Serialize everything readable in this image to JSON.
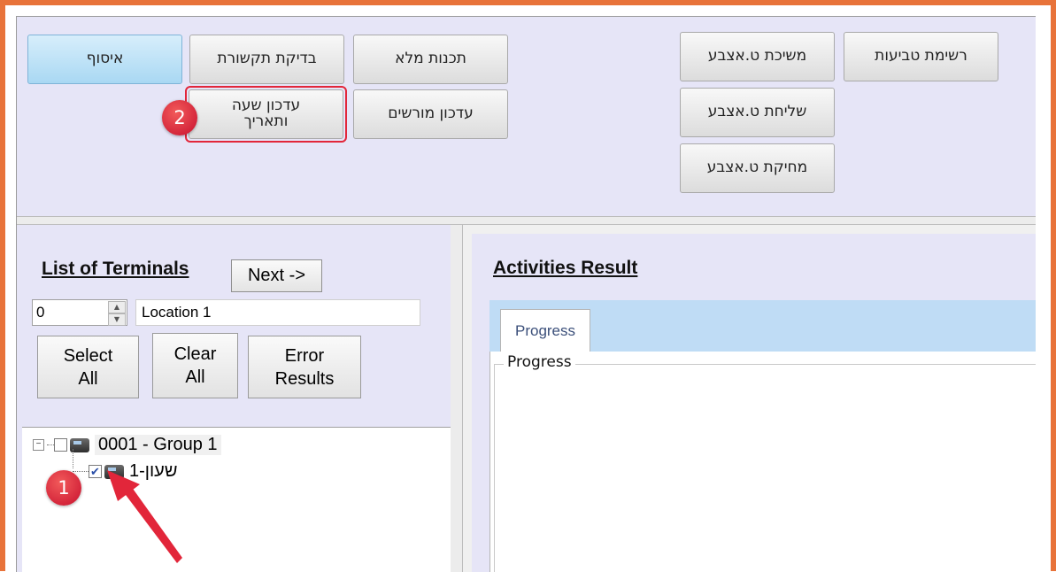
{
  "toolbar": {
    "buttons": {
      "assemble": "איסוף",
      "check_connection": "בדיקת תקשורת",
      "full_program": "תכנות מלא",
      "update_time_date": "עדכון שעה\nותאריך",
      "update_permitted": "עדכון מורשים",
      "pull_fingerprint": "משיכת ט.אצבע",
      "fingerprint_list": "רשימת טביעות",
      "send_fingerprint": "שליחת ט.אצבע",
      "delete_fingerprint": "מחיקת ט.אצבע"
    }
  },
  "badges": {
    "one": "1",
    "two": "2"
  },
  "terminals": {
    "title": "List of Terminals",
    "next_label": "Next ->",
    "spin_value": "0",
    "location_value": "Location 1",
    "select_all": "Select\nAll",
    "clear_all": "Clear\nAll",
    "error_results": "Error\nResults",
    "tree": {
      "group_label": "0001 - Group 1",
      "group_checked": false,
      "child_label": "שעון-1",
      "child_checked": true
    }
  },
  "activities": {
    "title": "Activities Result",
    "tab_label": "Progress",
    "group_label": "Progress"
  },
  "colors": {
    "frame": "#e8733a",
    "highlight": "#e2263a",
    "panel": "#e6e5f7",
    "tab_strip": "#bfdcf5"
  }
}
